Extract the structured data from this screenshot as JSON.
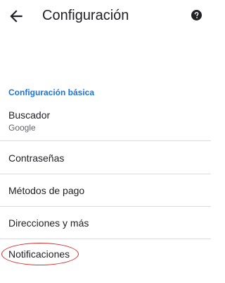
{
  "header": {
    "title": "Configuración",
    "back_icon": "arrow-back-icon",
    "help_icon": "help-icon"
  },
  "section": {
    "title": "Configuración básica",
    "color": "#1a73e8"
  },
  "settings": {
    "search_engine": {
      "label": "Buscador",
      "value": "Google"
    },
    "passwords": {
      "label": "Contraseñas"
    },
    "payment_methods": {
      "label": "Métodos de pago"
    },
    "addresses": {
      "label": "Direcciones y más"
    },
    "notifications": {
      "label": "Notificaciones"
    }
  },
  "annotation": {
    "highlight_color": "#d32f2f"
  }
}
